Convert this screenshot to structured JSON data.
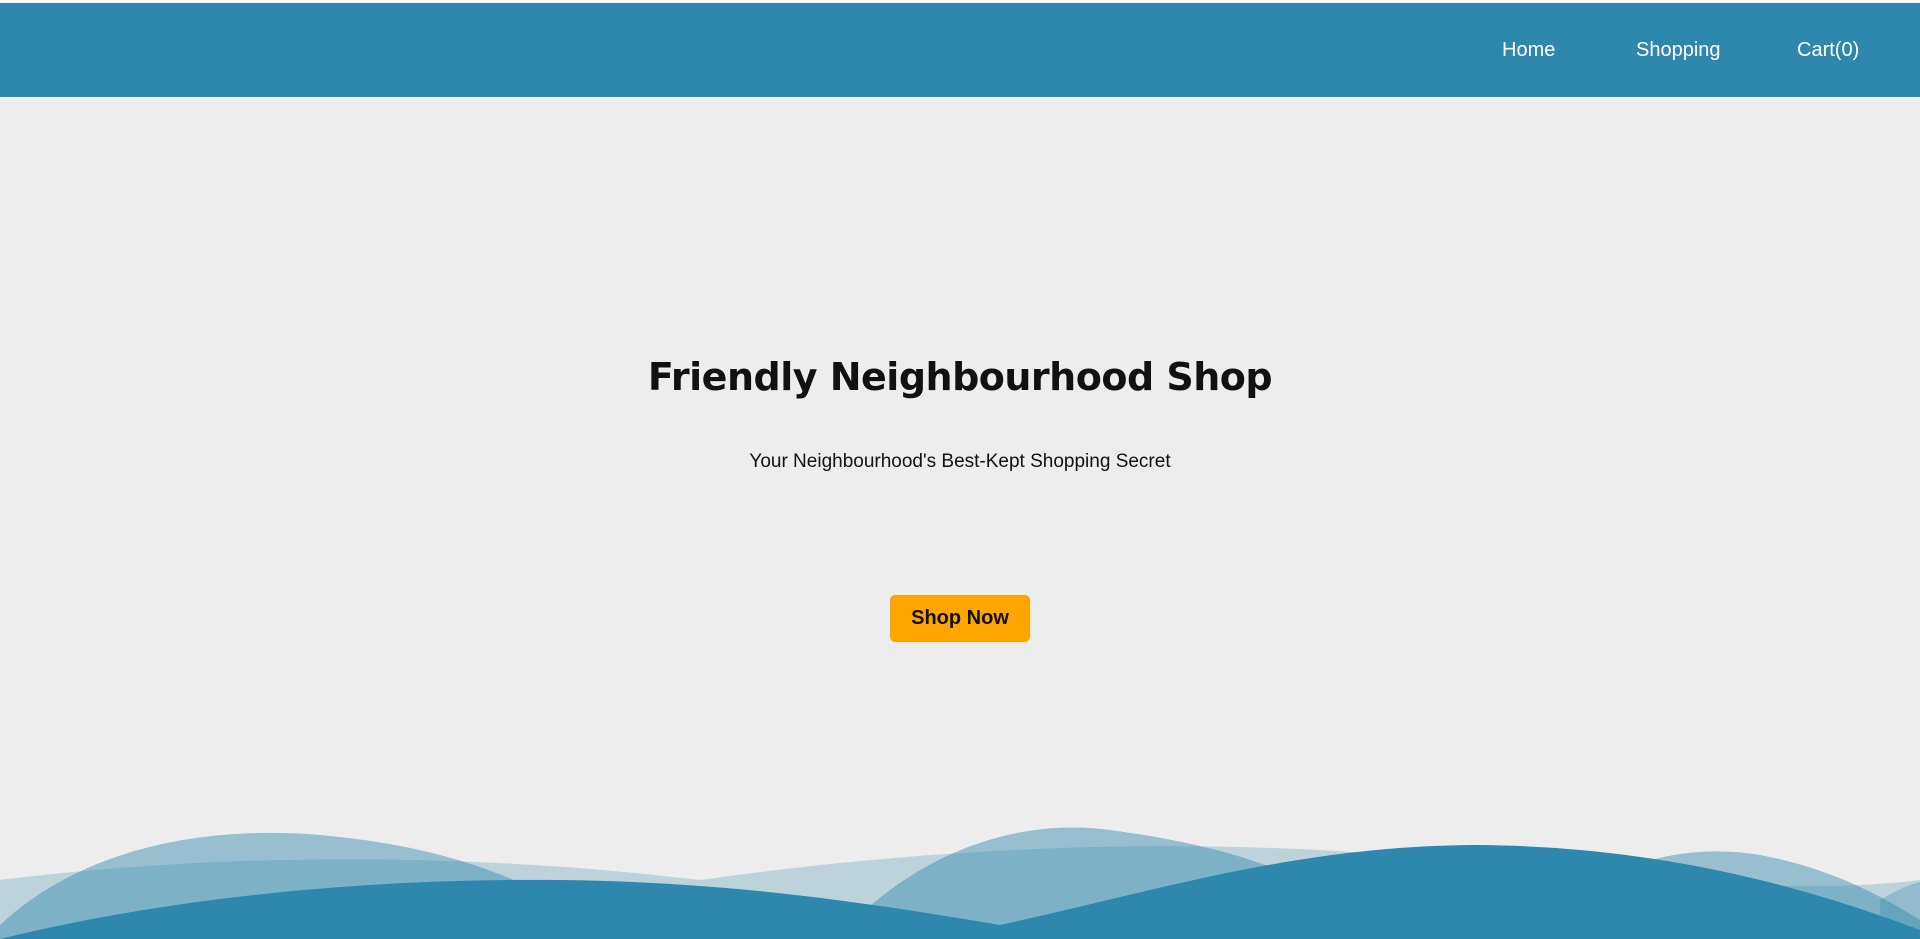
{
  "nav": {
    "home_label": "Home",
    "shopping_label": "Shopping",
    "cart_label": "Cart(0)"
  },
  "hero": {
    "title": "Friendly Neighbourhood Shop",
    "subtitle": "Your Neighbourhood's Best-Kept Shopping Secret",
    "cta_label": "Shop Now"
  },
  "colors": {
    "header_bg": "#2e87ad",
    "page_bg": "#ededed",
    "cta_bg": "#ffa500",
    "wave_color": "#2e87ad"
  }
}
